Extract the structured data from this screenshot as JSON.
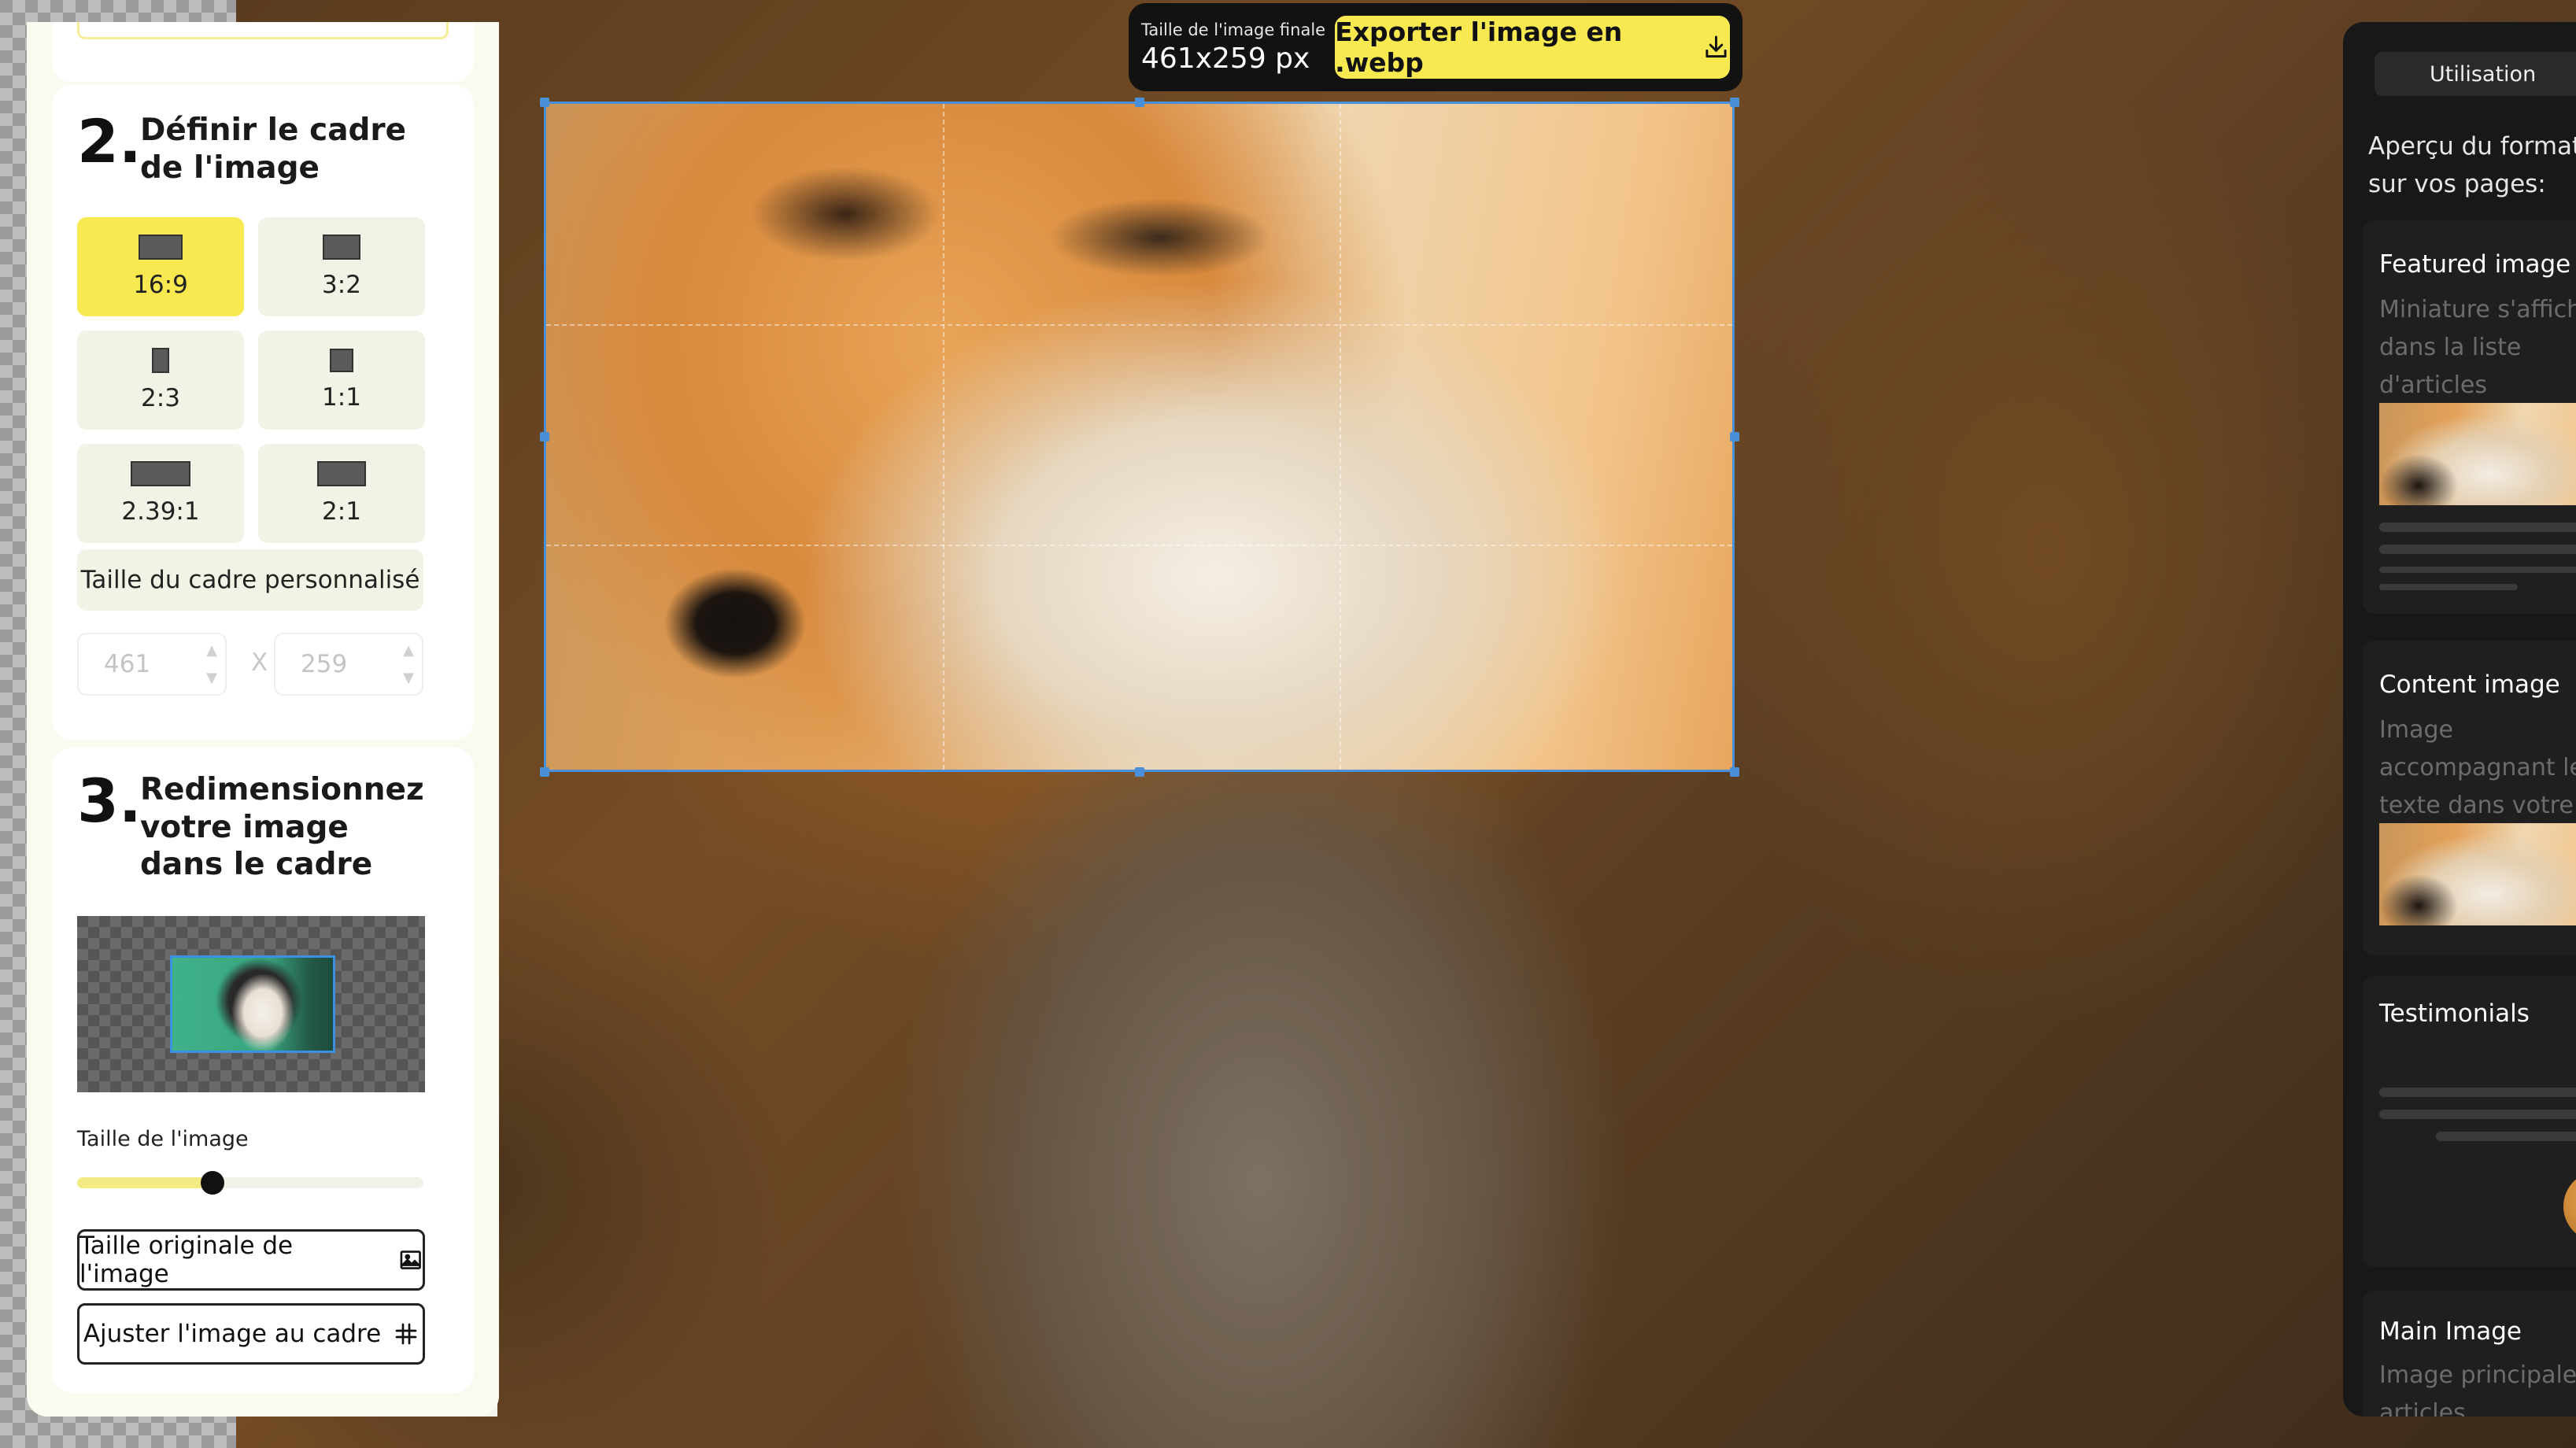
{
  "toolbar": {
    "final_size_label": "Taille de l'image finale",
    "final_size_value": "461x259 px",
    "export_label": "Exporter l'image en .webp"
  },
  "sidebar": {
    "step2": {
      "number": "2.",
      "title": "Définir le cadre de l'image",
      "ratios": [
        {
          "label": "16:9",
          "active": true
        },
        {
          "label": "3:2",
          "active": false
        },
        {
          "label": "2:3",
          "active": false
        },
        {
          "label": "1:1",
          "active": false
        },
        {
          "label": "2.39:1",
          "active": false
        },
        {
          "label": "2:1",
          "active": false
        }
      ],
      "custom_label": "Taille du cadre personnalisé",
      "width_value": "461",
      "height_value": "259",
      "times_sign": "X"
    },
    "step3": {
      "number": "3.",
      "title": "Redimensionnez votre image dans le cadre",
      "image_size_label": "Taille de l'image",
      "image_size_fraction": 0.39,
      "original_size_label": "Taille originale de l'image",
      "fit_label": "Ajuster l'image au cadre"
    }
  },
  "right_panel": {
    "tab_label": "Utilisation",
    "heading": "Aperçu du format sur vos pages:",
    "cards": [
      {
        "title": "Featured image",
        "desc": "Miniature s'affichant dans la liste d'articles"
      },
      {
        "title": "Content image",
        "desc": "Image accompagnant le texte dans votre page"
      },
      {
        "title": "Testimonials",
        "desc": ""
      },
      {
        "title": "Main Image",
        "desc": "Image principale des articles"
      }
    ]
  },
  "colors": {
    "accent": "#f7e94f",
    "crop_border": "#4a90d9",
    "dark_panel": "#181818"
  },
  "icons": {
    "export": "download-icon",
    "original_size": "image-icon",
    "fit": "crop-icon",
    "spinner": "chevron-up-down-icon"
  }
}
